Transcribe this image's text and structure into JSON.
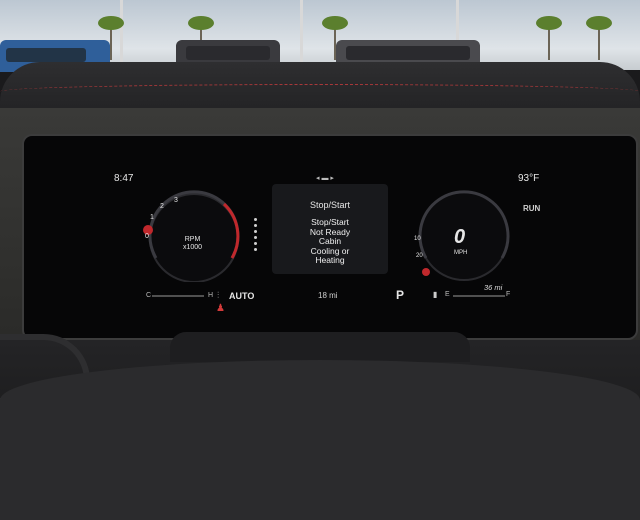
{
  "cluster": {
    "clock": "8:47",
    "outside_temp": "93°F",
    "drive_mode": "RUN",
    "tachometer": {
      "label_line1": "RPM",
      "label_line2": "x1000",
      "ticks": [
        "0",
        "1",
        "2",
        "3"
      ]
    },
    "speedometer": {
      "value": "0",
      "unit": "MPH",
      "ticks": [
        "10",
        "20"
      ]
    },
    "center_panel": {
      "nav_indicator": "◂ ▬ ▸",
      "title": "Stop/Start",
      "message_lines": [
        "Stop/Start",
        "Not Ready",
        "Cabin",
        "Cooling or",
        "Heating"
      ]
    },
    "bottom_bar": {
      "temp_cold": "C",
      "temp_hot": "H",
      "climate_mode": "AUTO",
      "trip": "18 mi",
      "gear": "P",
      "fuel_empty": "E",
      "fuel_full": "F",
      "range": "36 mi"
    },
    "colors": {
      "accent_red": "#d23a3a",
      "text": "#e6e6e6"
    }
  }
}
